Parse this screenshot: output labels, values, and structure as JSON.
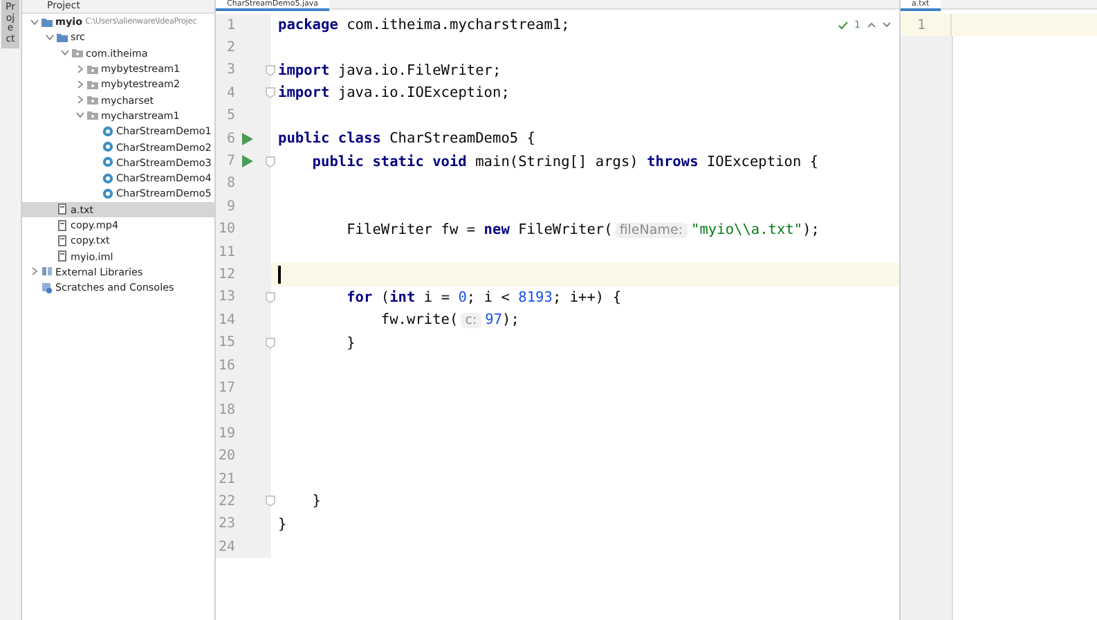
{
  "side_tab": {
    "label": "Project"
  },
  "project": {
    "title": "Project",
    "tree": [
      {
        "name": "myio",
        "path": "C:\\Users\\alienware\\IdeaProjec",
        "kind": "module",
        "expanded": true,
        "selected": false,
        "children": [
          {
            "name": "src",
            "kind": "source",
            "expanded": true,
            "selected": false,
            "children": [
              {
                "name": "com.itheima",
                "kind": "package",
                "expanded": true,
                "selected": false,
                "children": [
                  {
                    "name": "mybytestream1",
                    "kind": "package",
                    "expanded": false,
                    "selected": false
                  },
                  {
                    "name": "mybytestream2",
                    "kind": "package",
                    "expanded": false,
                    "selected": false
                  },
                  {
                    "name": "mycharset",
                    "kind": "package",
                    "expanded": false,
                    "selected": false
                  },
                  {
                    "name": "mycharstream1",
                    "kind": "package",
                    "expanded": true,
                    "selected": false,
                    "children": [
                      {
                        "name": "CharStreamDemo1",
                        "kind": "class",
                        "selected": false
                      },
                      {
                        "name": "CharStreamDemo2",
                        "kind": "class",
                        "selected": false
                      },
                      {
                        "name": "CharStreamDemo3",
                        "kind": "class",
                        "selected": false
                      },
                      {
                        "name": "CharStreamDemo4",
                        "kind": "class",
                        "selected": false
                      },
                      {
                        "name": "CharStreamDemo5",
                        "kind": "class",
                        "selected": false
                      }
                    ]
                  }
                ]
              }
            ]
          },
          {
            "name": "a.txt",
            "kind": "file",
            "selected": true
          },
          {
            "name": "copy.mp4",
            "kind": "file",
            "selected": false
          },
          {
            "name": "copy.txt",
            "kind": "file",
            "selected": false
          },
          {
            "name": "myio.iml",
            "kind": "file",
            "selected": false
          }
        ]
      },
      {
        "name": "External Libraries",
        "kind": "library",
        "expanded": false,
        "selected": false
      },
      {
        "name": "Scratches and Consoles",
        "kind": "scratch",
        "selected": false
      }
    ]
  },
  "editor": {
    "tab": "CharStreamDemo5.java",
    "inspection_count": "1",
    "lines": [
      {
        "number": "1",
        "tokens": [
          {
            "kind": "keyword",
            "text": "package"
          },
          {
            "kind": "plain",
            "text": " com.itheima.mycharstream1;"
          }
        ]
      },
      {
        "number": "2"
      },
      {
        "number": "3",
        "fold": true,
        "tokens": [
          {
            "kind": "keyword",
            "text": "import"
          },
          {
            "kind": "plain",
            "text": " java.io.FileWriter;"
          }
        ]
      },
      {
        "number": "4",
        "fold": true,
        "tokens": [
          {
            "kind": "keyword",
            "text": "import"
          },
          {
            "kind": "plain",
            "text": " java.io.IOException;"
          }
        ]
      },
      {
        "number": "5"
      },
      {
        "number": "6",
        "run": true,
        "tokens": [
          {
            "kind": "keyword",
            "text": "public class"
          },
          {
            "kind": "plain",
            "text": " CharStreamDemo5 {"
          }
        ]
      },
      {
        "number": "7",
        "run": true,
        "fold": true,
        "tokens": [
          {
            "kind": "keyword",
            "text": "    public static void"
          },
          {
            "kind": "plain",
            "text": " main(String[] args) "
          },
          {
            "kind": "keyword",
            "text": "throws"
          },
          {
            "kind": "plain",
            "text": " IOException {"
          }
        ]
      },
      {
        "number": "8"
      },
      {
        "number": "9"
      },
      {
        "number": "10",
        "tokens": [
          {
            "kind": "plain",
            "text": "        FileWriter fw = "
          },
          {
            "kind": "keyword",
            "text": "new"
          },
          {
            "kind": "plain",
            "text": " FileWriter("
          },
          {
            "kind": "hint",
            "text": "fileName:"
          },
          {
            "kind": "string",
            "text": "\"myio\\\\a.txt\""
          },
          {
            "kind": "plain",
            "text": ");"
          }
        ]
      },
      {
        "number": "11"
      },
      {
        "number": "12",
        "current": true
      },
      {
        "number": "13",
        "fold": true,
        "tokens": [
          {
            "kind": "keyword",
            "text": "        for"
          },
          {
            "kind": "plain",
            "text": " ("
          },
          {
            "kind": "keyword",
            "text": "int"
          },
          {
            "kind": "plain",
            "text": " i = "
          },
          {
            "kind": "number",
            "text": "0"
          },
          {
            "kind": "plain",
            "text": "; i < "
          },
          {
            "kind": "number",
            "text": "8193"
          },
          {
            "kind": "plain",
            "text": "; i++) {"
          }
        ]
      },
      {
        "number": "14",
        "tokens": [
          {
            "kind": "plain",
            "text": "            fw.write("
          },
          {
            "kind": "hint",
            "text": "c:"
          },
          {
            "kind": "number",
            "text": "97"
          },
          {
            "kind": "plain",
            "text": ");"
          }
        ]
      },
      {
        "number": "15",
        "fold": true,
        "tokens": [
          {
            "kind": "plain",
            "text": "        }"
          }
        ]
      },
      {
        "number": "16"
      },
      {
        "number": "17"
      },
      {
        "number": "18"
      },
      {
        "number": "19"
      },
      {
        "number": "20"
      },
      {
        "number": "21"
      },
      {
        "number": "22",
        "fold": true,
        "tokens": [
          {
            "kind": "plain",
            "text": "    }"
          }
        ]
      },
      {
        "number": "23",
        "tokens": [
          {
            "kind": "plain",
            "text": "}"
          }
        ]
      },
      {
        "number": "24"
      }
    ]
  },
  "side_editor": {
    "tab": "a.txt",
    "lines": [
      {
        "number": "1",
        "current": true
      }
    ]
  }
}
